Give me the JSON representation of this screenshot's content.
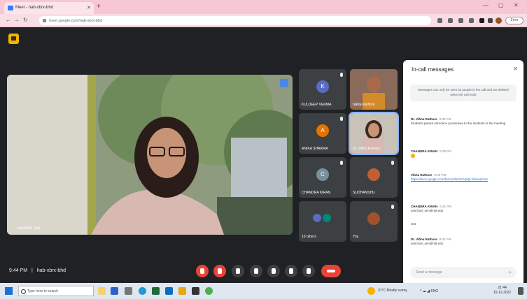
{
  "browser": {
    "tab_title": "Meet - hab-xbrx-bhd",
    "tab_close": "✕",
    "new_tab": "+",
    "win_min": "—",
    "win_max": "▢",
    "win_close": "✕",
    "url": "meet.google.com/hab-xbrx-bhd",
    "update_label": "Error"
  },
  "meeting": {
    "main_speaker_name": "Lakshmi Iyer",
    "time": "9:44 PM",
    "separator": "|",
    "meeting_code": "hab-xbrx-bhd"
  },
  "participants": [
    {
      "name": "KULDEEP VERMA",
      "initial": "K",
      "color": "#5c6bc0"
    },
    {
      "name": "Nikita Rathore",
      "initial": "",
      "color": "#a0522d"
    },
    {
      "name": "ANIKA SHARMA",
      "initial": "A",
      "color": "#e37400"
    },
    {
      "name": "Dr. Vibha Rathore",
      "initial": "",
      "color": "#6d4c41"
    },
    {
      "name": "CHANDRA KIRAN",
      "initial": "C",
      "color": "#78909c"
    },
    {
      "name": "SUDHANSHU",
      "initial": "",
      "color": "#c06030"
    },
    {
      "name": "10 others",
      "initial": "",
      "color": "#3c4043"
    },
    {
      "name": "You",
      "initial": "",
      "color": "#a0522d"
    }
  ],
  "chat": {
    "title": "In-call messages",
    "close": "✕",
    "notice": "Messages can only be seen by people in the call and are deleted when the call ends",
    "messages": [
      {
        "sender": "Dr. Vibha Rathore",
        "time": "9:38 PM",
        "text": "Students please introduce yourselves to the students in the meeting"
      },
      {
        "sender": "CHANDRA KIRAN",
        "time": "9:39 PM",
        "text": ""
      },
      {
        "sender": "Vibha Rathore",
        "time": "9:40 PM",
        "text": "https://docs.google.com/forms/d/e/1FAIpQLSf/viewform"
      },
      {
        "sender": "CHANDRA KIRAN",
        "time": "9:41 PM",
        "text": "sanchari_sen@nitt.edu"
      },
      {
        "sender": "",
        "time": "",
        "text": "test"
      },
      {
        "sender": "Dr. Vibha Rathore",
        "time": "9:42 PM",
        "text": "sanchari_sen@nitt.edu"
      }
    ],
    "input_placeholder": "Send a message",
    "send_icon": "➤"
  },
  "taskbar": {
    "search_placeholder": "Type here to search",
    "weather": "31°C Mostly sunny",
    "tray": "^ ☁ ◢ ENG",
    "clock_time": "21:44",
    "clock_date": "15-11-2022"
  },
  "colors": {
    "meet_bg": "#202124",
    "accent": "#8ab4f8",
    "end_call": "#ea4335"
  }
}
